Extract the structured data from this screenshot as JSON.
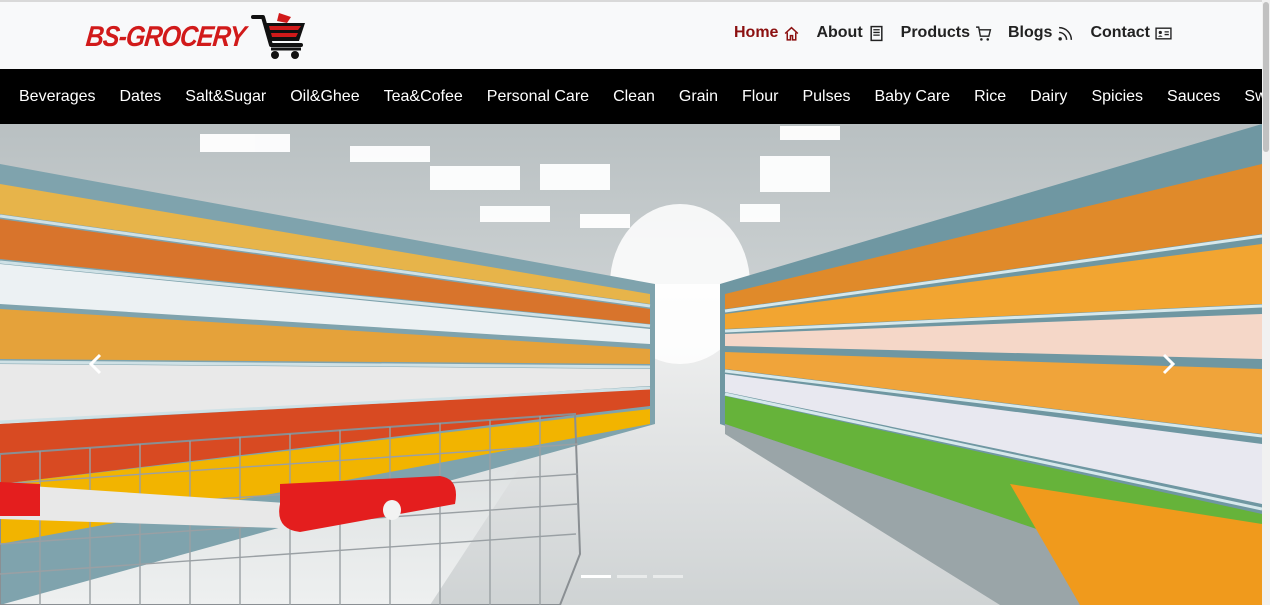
{
  "brand": {
    "logo_text": "BS-GROCERY"
  },
  "nav": [
    {
      "label": "Home",
      "icon": "house-icon",
      "active": true
    },
    {
      "label": "About",
      "icon": "book-icon",
      "active": false
    },
    {
      "label": "Products",
      "icon": "cart-icon",
      "active": false
    },
    {
      "label": "Blogs",
      "icon": "rss-icon",
      "active": false
    },
    {
      "label": "Contact",
      "icon": "contact-card-icon",
      "active": false
    }
  ],
  "categories": [
    "Beverages",
    "Dates",
    "Salt&Sugar",
    "Oil&Ghee",
    "Tea&Cofee",
    "Personal Care",
    "Clean",
    "Grain",
    "Flour",
    "Pulses",
    "Baby Care",
    "Rice",
    "Dairy",
    "Spicies",
    "Sauces",
    "Sweet"
  ],
  "carousel": {
    "slides": 3,
    "active_slide": 1
  },
  "colors": {
    "brand_red": "#d11a1a",
    "active_nav": "#8b1010",
    "category_bar": "#000000",
    "header_bg": "#f8f9fa"
  }
}
